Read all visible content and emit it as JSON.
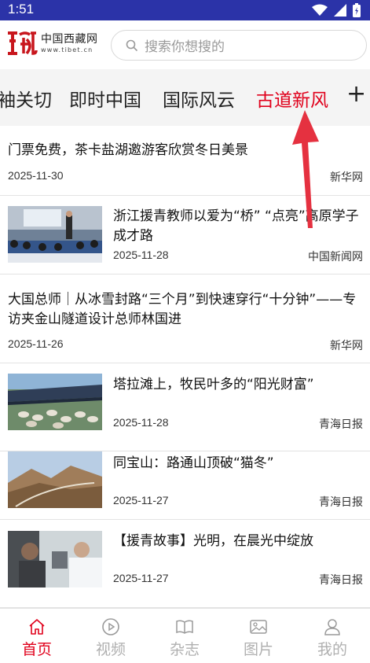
{
  "status_bar": {
    "time": "1:51"
  },
  "header": {
    "logo_cn": "中国西藏网",
    "logo_en": "www.tibet.cn",
    "search_placeholder": "搜索你想搜的"
  },
  "tabs": [
    "袖关切",
    "即时中国",
    "国际风云",
    "古道新风"
  ],
  "active_tab": "古道新风",
  "tab_add_label": "+",
  "news": [
    {
      "title": "门票免费，茶卡盐湖邀游客欣赏冬日美景",
      "date": "2025-11-30",
      "source": "新华网",
      "thumb_icon": ""
    },
    {
      "title": "浙江援青教师以爱为“桥” “点亮”高原学子成才路",
      "date": "2025-11-28",
      "source": "中国新闻网",
      "thumb_icon": "classroom-photo"
    },
    {
      "title": "大国总师｜从冰雪封路“三个月”到快速穿行“十分钟”——专访夹金山隧道设计总师林国进",
      "date": "2025-11-26",
      "source": "新华网",
      "thumb_icon": ""
    },
    {
      "title": "塔拉滩上，牧民叶多的“阳光财富”",
      "date": "2025-11-28",
      "source": "青海日报",
      "thumb_icon": "solar-sheep-photo"
    },
    {
      "title": "同宝山：路通山顶破“猫冬”",
      "date": "2025-11-27",
      "source": "青海日报",
      "thumb_icon": "mountain-road-photo"
    },
    {
      "title": "【援青故事】光明，在晨光中绽放",
      "date": "2025-11-27",
      "source": "青海日报",
      "thumb_icon": "doctor-photo"
    }
  ],
  "bottom_nav": [
    {
      "label": "首页",
      "icon": "home-icon",
      "active": true
    },
    {
      "label": "视频",
      "icon": "video-icon",
      "active": false
    },
    {
      "label": "杂志",
      "icon": "magazine-icon",
      "active": false
    },
    {
      "label": "图片",
      "icon": "picture-icon",
      "active": false
    },
    {
      "label": "我的",
      "icon": "user-icon",
      "active": false
    }
  ],
  "colors": {
    "status_bar": "#2b33a8",
    "accent": "#e0001b",
    "logo_red": "#c8161d"
  }
}
